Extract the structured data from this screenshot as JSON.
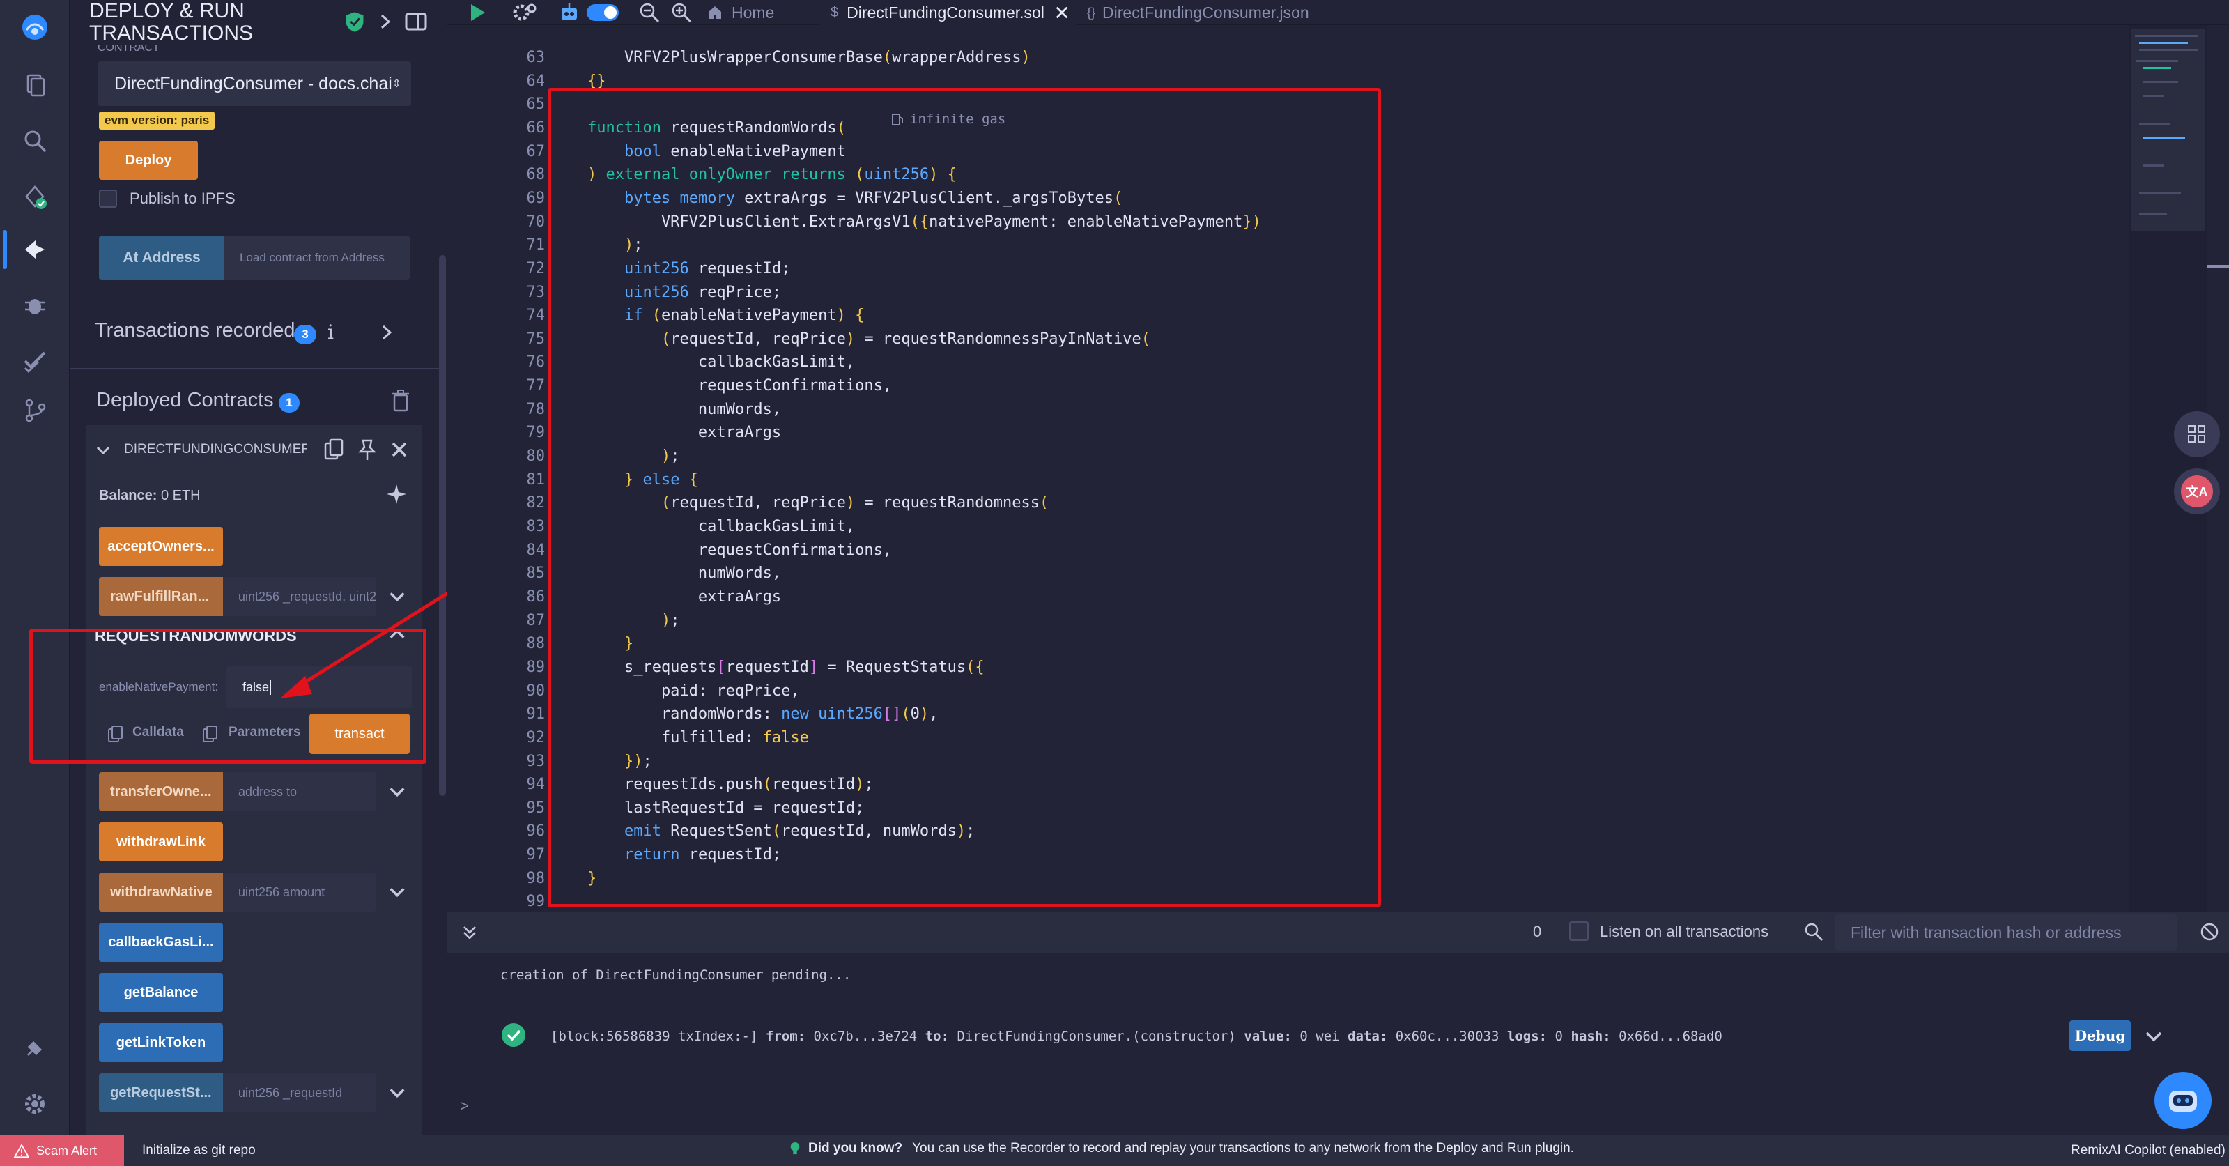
{
  "panel": {
    "title_line1": "DEPLOY & RUN",
    "title_line2": "TRANSACTIONS",
    "contract_label_cut": "CONTRACT",
    "contract_select": "DirectFundingConsumer - docs.chai",
    "evm_version": "evm version: paris",
    "deploy_label": "Deploy",
    "publish_ipfs_label": "Publish to IPFS",
    "at_address_label": "At Address",
    "load_contract_placeholder": "Load contract from Address",
    "transactions_recorded_label": "Transactions recorded",
    "transactions_recorded_count": "3",
    "info_glyph": "i",
    "deployed_contracts_label": "Deployed Contracts",
    "deployed_contracts_count": "1",
    "instance_name": "DIRECTFUNDINGCONSUMER A",
    "balance_label": "Balance:",
    "balance_value": "0 ETH",
    "functions": [
      {
        "label": "acceptOwners...",
        "kind": "orange",
        "arg": ""
      },
      {
        "label": "rawFulfillRan...",
        "kind": "orange-dim",
        "arg": "uint256 _requestId, uint2"
      }
    ],
    "expanded": {
      "title": "REQUESTRANDOMWORDS",
      "param_label": "enableNativePayment:",
      "param_value": "false",
      "calldata_label": "Calldata",
      "parameters_label": "Parameters",
      "transact_label": "transact"
    },
    "functions_after": [
      {
        "label": "transferOwne...",
        "kind": "orange-dim",
        "arg": "address to"
      },
      {
        "label": "withdrawLink",
        "kind": "orange",
        "arg": ""
      },
      {
        "label": "withdrawNative",
        "kind": "orange-dim",
        "arg": "uint256 amount"
      },
      {
        "label": "callbackGasLi...",
        "kind": "blue",
        "arg": ""
      },
      {
        "label": "getBalance",
        "kind": "blue",
        "arg": ""
      },
      {
        "label": "getLinkToken",
        "kind": "blue",
        "arg": ""
      },
      {
        "label": "getRequestSt...",
        "kind": "blue-dim",
        "arg": "uint256 _requestId"
      }
    ]
  },
  "tabs": {
    "home": "Home",
    "sol_file": "DirectFundingConsumer.sol",
    "json_file": "DirectFundingConsumer.json"
  },
  "editor": {
    "gas_hint": "infinite gas",
    "lines": [
      {
        "n": "63",
        "t": "        VRFV2PlusWrapperConsumerBase(wrapperAddress)"
      },
      {
        "n": "64",
        "t": "    {}"
      },
      {
        "n": "65",
        "t": ""
      },
      {
        "n": "66",
        "t": "    function requestRandomWords("
      },
      {
        "n": "67",
        "t": "        bool enableNativePayment"
      },
      {
        "n": "68",
        "t": "    ) external onlyOwner returns (uint256) {"
      },
      {
        "n": "69",
        "t": "        bytes memory extraArgs = VRFV2PlusClient._argsToBytes("
      },
      {
        "n": "70",
        "t": "            VRFV2PlusClient.ExtraArgsV1({nativePayment: enableNativePayment})"
      },
      {
        "n": "71",
        "t": "        );"
      },
      {
        "n": "72",
        "t": "        uint256 requestId;"
      },
      {
        "n": "73",
        "t": "        uint256 reqPrice;"
      },
      {
        "n": "74",
        "t": "        if (enableNativePayment) {"
      },
      {
        "n": "75",
        "t": "            (requestId, reqPrice) = requestRandomnessPayInNative("
      },
      {
        "n": "76",
        "t": "                callbackGasLimit,"
      },
      {
        "n": "77",
        "t": "                requestConfirmations,"
      },
      {
        "n": "78",
        "t": "                numWords,"
      },
      {
        "n": "79",
        "t": "                extraArgs"
      },
      {
        "n": "80",
        "t": "            );"
      },
      {
        "n": "81",
        "t": "        } else {"
      },
      {
        "n": "82",
        "t": "            (requestId, reqPrice) = requestRandomness("
      },
      {
        "n": "83",
        "t": "                callbackGasLimit,"
      },
      {
        "n": "84",
        "t": "                requestConfirmations,"
      },
      {
        "n": "85",
        "t": "                numWords,"
      },
      {
        "n": "86",
        "t": "                extraArgs"
      },
      {
        "n": "87",
        "t": "            );"
      },
      {
        "n": "88",
        "t": "        }"
      },
      {
        "n": "89",
        "t": "        s_requests[requestId] = RequestStatus({"
      },
      {
        "n": "90",
        "t": "            paid: reqPrice,"
      },
      {
        "n": "91",
        "t": "            randomWords: new uint256[](0),"
      },
      {
        "n": "92",
        "t": "            fulfilled: false"
      },
      {
        "n": "93",
        "t": "        });"
      },
      {
        "n": "94",
        "t": "        requestIds.push(requestId);"
      },
      {
        "n": "95",
        "t": "        lastRequestId = requestId;"
      },
      {
        "n": "96",
        "t": "        emit RequestSent(requestId, numWords);"
      },
      {
        "n": "97",
        "t": "        return requestId;"
      },
      {
        "n": "98",
        "t": "    }"
      },
      {
        "n": "99",
        "t": ""
      }
    ]
  },
  "terminal": {
    "pending_count": "0",
    "listen_label": "Listen on all transactions",
    "filter_placeholder": "Filter with transaction hash or address",
    "pending_line": "creation of DirectFundingConsumer pending...",
    "tx_block": "[block:56586839 txIndex:-]",
    "tx_from_k": "from:",
    "tx_from_v": "0xc7b...3e724",
    "tx_to_k": "to:",
    "tx_to_v": "DirectFundingConsumer.(constructor)",
    "tx_value_k": "value:",
    "tx_value_v": "0 wei",
    "tx_data_k": "data:",
    "tx_data_v": "0x60c...30033",
    "tx_logs_k": "logs:",
    "tx_logs_v": "0",
    "tx_hash_k": "hash:",
    "tx_hash_v": "0x66d...68ad0",
    "debug_label": "Debug",
    "prompt": ">"
  },
  "status": {
    "scam_alert": "Scam Alert",
    "init_git": "Initialize as git repo",
    "did_you_know": "Did you know?",
    "tip": "You can use the Recorder to record and replay your transactions to any network from the Deploy and Run plugin.",
    "copilot": "RemixAI Copilot (enabled)"
  },
  "colors": {
    "accent_orange": "#d97b2c",
    "accent_blue": "#2c6db5",
    "annotation_red": "#e0121b",
    "success_green": "#2fb380"
  }
}
